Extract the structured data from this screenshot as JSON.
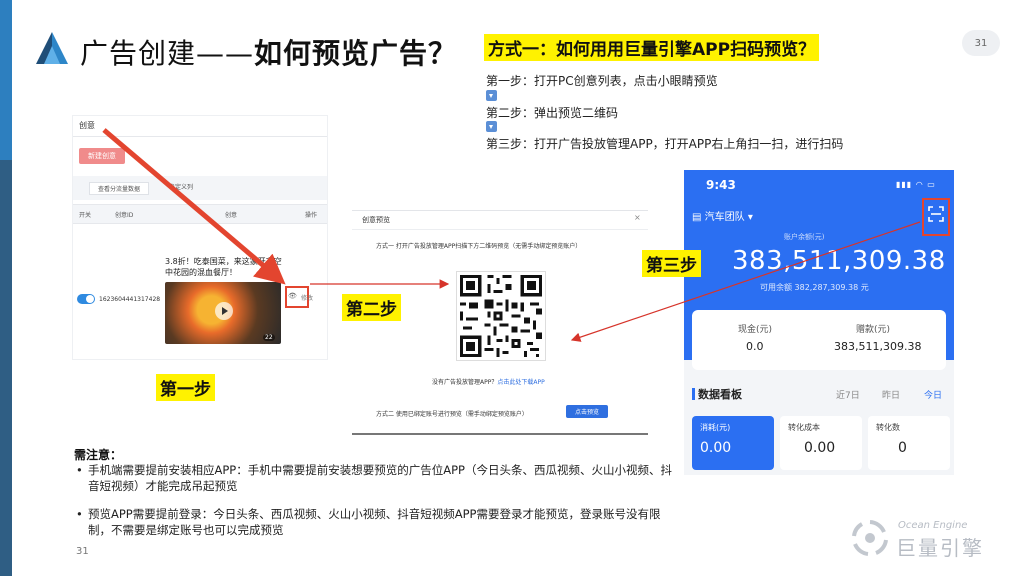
{
  "page": {
    "title_light": "广告创建——",
    "title_bold": "如何预览广告？",
    "page_badge": "31",
    "page_number": "31"
  },
  "method": {
    "title": "方式一：如何用用巨量引擎APP扫码预览？",
    "steps": [
      "第一步：打开PC创意列表，点击小眼睛预览",
      "第二步：弹出预览二维码",
      "第三步：打开广告投放管理APP，打开APP右上角扫一扫，进行扫码"
    ]
  },
  "step_labels": {
    "one": "第一步",
    "two": "第二步",
    "three": "第三步"
  },
  "pc_screenshot": {
    "tab": "创意",
    "new_button": "新建创意",
    "filter_button": "查看分流量数据",
    "custom_columns": "自定义列",
    "columns": [
      "开关",
      "创意ID",
      "创意",
      "操作"
    ],
    "row": {
      "id": "1623604441317428",
      "ad_text": "3.8折！吃泰国菜，来这家开在空中花园的混血餐厅！",
      "duration": "22",
      "edit": "修改"
    }
  },
  "preview_popup": {
    "title": "创意预览",
    "close": "×",
    "method_one": "方式一   打开广告投放管理APP扫描下方二维码预览（无需手动绑定预览账户）",
    "download_prefix": "没有广告投放管理APP？",
    "download_link": "点击此处下载APP",
    "method_two": "方式二   使用已绑定账号进行预览（需手动绑定预览账户）",
    "preview_button": "点击预览"
  },
  "phone": {
    "time": "9:43",
    "status": "▮▮▮ ◠ ▭",
    "team": "汽车团队 ▾",
    "balance_label": "账户余额(元)",
    "balance": "383,511,309.38",
    "available": "可用余额 382,287,309.38 元",
    "cash_label": "现金(元)",
    "cash_value": "0.0",
    "gift_label": "赠款(元)",
    "gift_value": "383,511,309.38",
    "board_title": "数据看板",
    "tabs": [
      "近7日",
      "昨日",
      "今日"
    ],
    "metrics": [
      {
        "label": "消耗(元)",
        "value": "0.00"
      },
      {
        "label": "转化成本",
        "value": "0.00"
      },
      {
        "label": "转化数",
        "value": "0"
      }
    ]
  },
  "notes": {
    "title": "需注意：",
    "items": [
      "手机端需要提前安装相应APP：手机中需要提前安装想要预览的广告位APP（今日头条、西瓜视频、火山小视频、抖音短视频）才能完成吊起预览",
      "预览APP需要提前登录：今日头条、西瓜视频、火山小视频、抖音短视频APP需要登录才能预览，登录账号没有限制，不需要是绑定账号也可以完成预览"
    ]
  },
  "brand": {
    "en": "Ocean Engine",
    "cn": "巨量引擎"
  },
  "colors": {
    "highlight": "#fff200",
    "accent_red": "#e3452f",
    "brand_blue": "#2b6ff2"
  }
}
